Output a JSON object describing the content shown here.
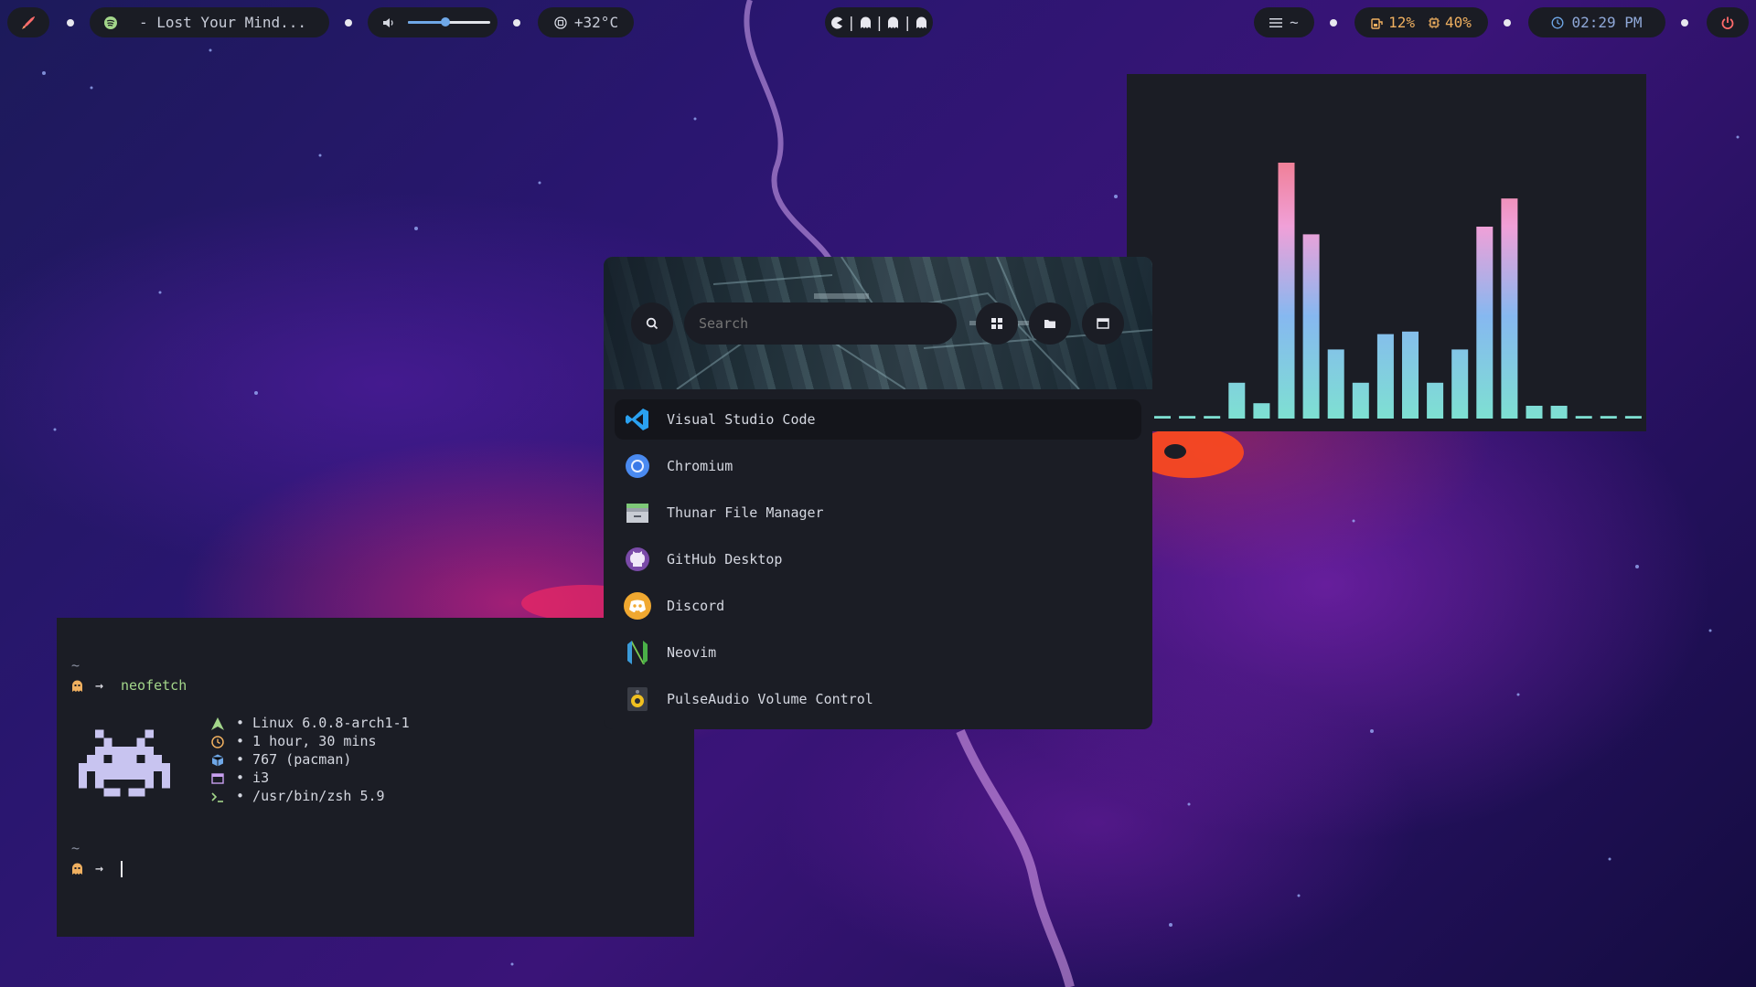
{
  "topbar": {
    "music_text": "- Lost Your Mind...",
    "volume_level": 0.45,
    "temperature": "+32°C",
    "workspaces": "◖|▲|▲|▲",
    "menu_label": "~",
    "battery": "12%",
    "cpu": "40%",
    "clock": "02:29 PM"
  },
  "launcher": {
    "search_placeholder": "Search",
    "apps": [
      {
        "label": "Visual Studio Code",
        "icon": "vscode-icon"
      },
      {
        "label": "Chromium",
        "icon": "chromium-icon"
      },
      {
        "label": "Thunar File Manager",
        "icon": "thunar-icon"
      },
      {
        "label": "GitHub Desktop",
        "icon": "github-icon"
      },
      {
        "label": "Discord",
        "icon": "discord-icon"
      },
      {
        "label": "Neovim",
        "icon": "neovim-icon"
      },
      {
        "label": "PulseAudio Volume Control",
        "icon": "pulseaudio-icon"
      }
    ]
  },
  "terminal": {
    "tilde1": "~",
    "arrow": "→",
    "command": "neofetch",
    "info": [
      {
        "icon": "arch-icon",
        "text": "• Linux 6.0.8-arch1-1"
      },
      {
        "icon": "clock-icon",
        "text": "• 1 hour, 30 mins"
      },
      {
        "icon": "package-icon",
        "text": "• 767 (pacman)"
      },
      {
        "icon": "window-icon",
        "text": "• i3"
      },
      {
        "icon": "shell-icon",
        "text": "• /usr/bin/zsh 5.9"
      }
    ],
    "tilde2": "~"
  },
  "visualizer": {
    "levels": [
      0.01,
      0.01,
      0.01,
      0.14,
      0.06,
      1.0,
      0.72,
      0.27,
      0.14,
      0.33,
      0.34,
      0.14,
      0.27,
      0.75,
      0.86,
      0.05,
      0.05,
      0.01,
      0.01,
      0.01
    ],
    "colors": {
      "low": "#7ee0d2",
      "mid": "#86b8f0",
      "high": "#f0a0d8",
      "top": "#f08098"
    }
  },
  "colors": {
    "bar_bg": "#1a1c24",
    "accent_blue": "#6fa8e8",
    "accent_red": "#ff6b6b",
    "green": "#a3d68a",
    "orange": "#f0b060"
  }
}
